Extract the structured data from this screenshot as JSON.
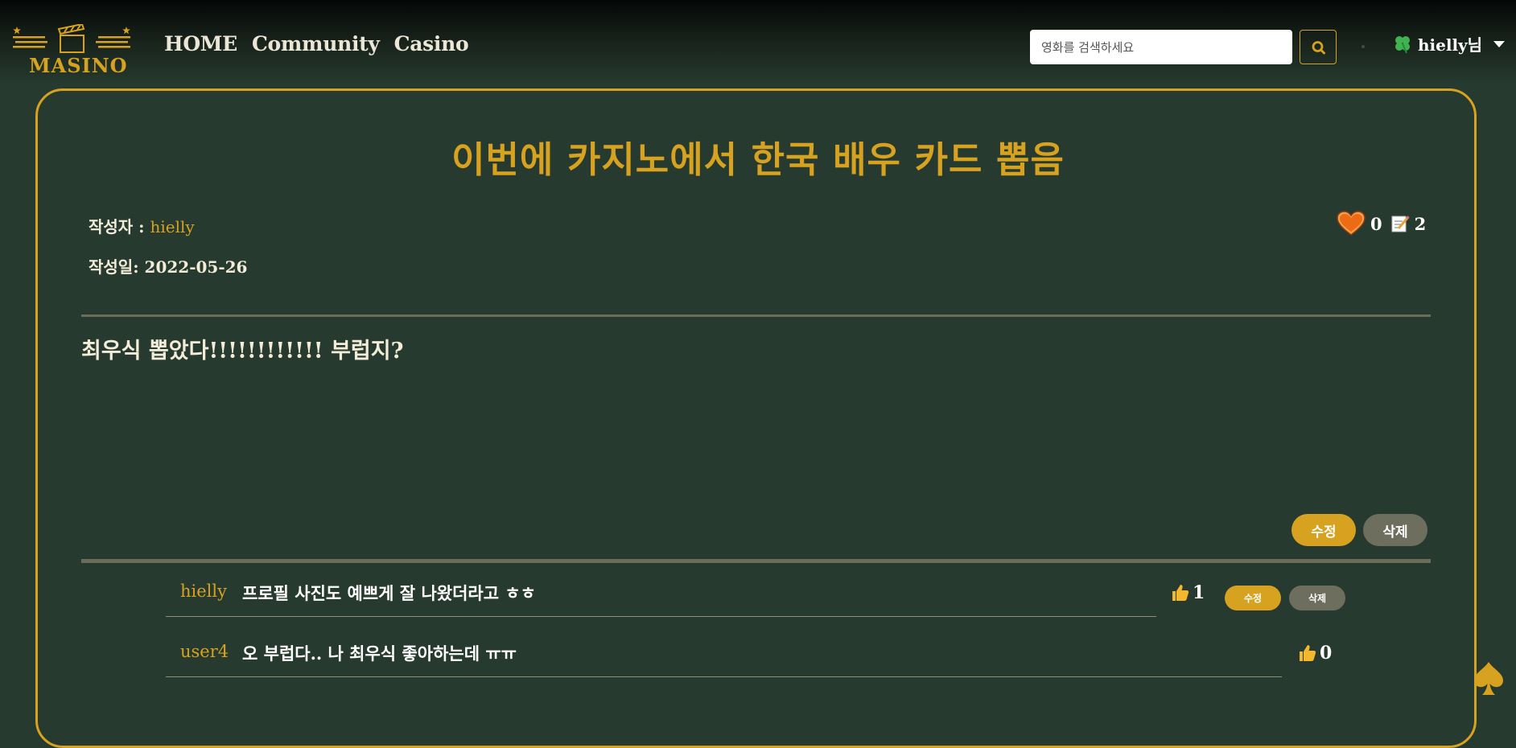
{
  "brand": {
    "name": "MASINO",
    "accent": "#d7a21f",
    "background": "#263a2f"
  },
  "nav": {
    "links": [
      "HOME",
      "Community",
      "Casino"
    ]
  },
  "search": {
    "placeholder": "영화를 검색하세요",
    "button_icon": "search-icon"
  },
  "user": {
    "icon": "four-leaf-clover-icon",
    "name": "hielly님"
  },
  "post": {
    "title": "이번에 카지노에서 한국 배우 카드 뽑음",
    "author_label": "작성자 : ",
    "author": "hielly",
    "date_label": "작성일: ",
    "date": "2022-05-26",
    "likes": "0",
    "comments_count": "2",
    "body": "최우식 뽑았다!!!!!!!!!!!! 부럽지?",
    "edit_label": "수정",
    "delete_label": "삭제"
  },
  "comments": [
    {
      "author": "hielly",
      "text": "프로필 사진도 예쁘게 잘 나왔더라고 ㅎㅎ",
      "likes": "1",
      "edit_label": "수정",
      "delete_label": "삭제"
    },
    {
      "author": "user4",
      "text": "오 부럽다.. 나 최우식 좋아하는데 ㅠㅠ",
      "likes": "0"
    }
  ],
  "icons": {
    "heart": "heart-icon",
    "memo": "memo-icon",
    "thumbs_up": "thumbs-up-icon",
    "spade": "spade-icon"
  }
}
